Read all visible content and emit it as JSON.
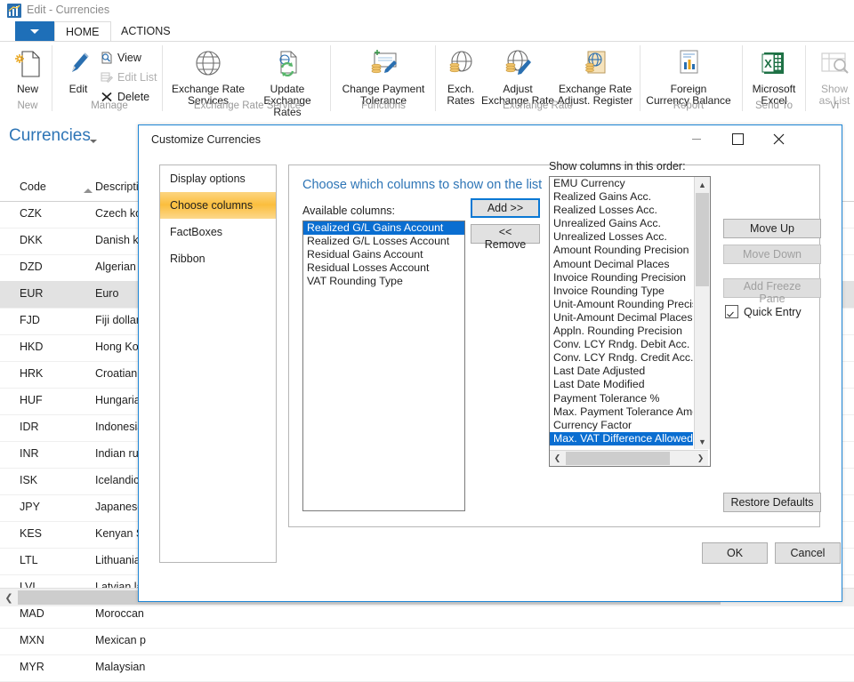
{
  "window": {
    "title": "Edit - Currencies",
    "app_icon": "chart-app-icon"
  },
  "ribbon": {
    "file_menu_label": "",
    "tabs": [
      {
        "label": "HOME",
        "active": true
      },
      {
        "label": "ACTIONS",
        "active": false
      }
    ],
    "groups": [
      {
        "name": "New",
        "items": [
          {
            "label": "New",
            "icon": "new-document-icon",
            "enabled": true
          }
        ]
      },
      {
        "name": "Manage",
        "items": [
          {
            "label": "Edit",
            "icon": "pencil-icon",
            "enabled": true
          },
          {
            "label": "View",
            "icon": "view-icon",
            "enabled": true
          },
          {
            "label": "Edit List",
            "icon": "edit-list-icon",
            "enabled": false
          },
          {
            "label": "Delete",
            "icon": "delete-x-icon",
            "enabled": true
          }
        ]
      },
      {
        "name": "Exchange Rate Service",
        "items": [
          {
            "label": "Exchange Rate\nServices",
            "icon": "globe-icon",
            "enabled": true
          },
          {
            "label": "Update\nExchange Rates",
            "icon": "update-rates-icon",
            "enabled": true
          }
        ]
      },
      {
        "name": "Functions",
        "items": [
          {
            "label": "Change Payment\nTolerance",
            "icon": "payment-tolerance-icon",
            "enabled": true
          }
        ]
      },
      {
        "name": "Exchange Rate",
        "items": [
          {
            "label": "Exch.\nRates",
            "icon": "exchange-rates-icon",
            "enabled": true
          },
          {
            "label": "Adjust\nExchange Rate",
            "icon": "adjust-exchange-rate-icon",
            "enabled": true
          },
          {
            "label": "Exchange Rate\nAdjust. Register",
            "icon": "exchange-rate-register-icon",
            "enabled": true
          }
        ]
      },
      {
        "name": "Report",
        "items": [
          {
            "label": "Foreign\nCurrency Balance",
            "icon": "report-chart-icon",
            "enabled": true
          }
        ]
      },
      {
        "name": "Send To",
        "items": [
          {
            "label": "Microsoft\nExcel",
            "icon": "excel-icon",
            "enabled": true
          }
        ]
      },
      {
        "name": "Vi",
        "items": [
          {
            "label": "Show\nas List",
            "icon": "show-as-list-icon",
            "enabled": false
          }
        ]
      }
    ]
  },
  "page": {
    "title": "Currencies",
    "columns": [
      "Code",
      "Description"
    ],
    "sort_column": "Code",
    "sort_direction": "ascending",
    "rows": [
      {
        "code": "CZK",
        "description": "Czech kor",
        "selected": false
      },
      {
        "code": "DKK",
        "description": "Danish kro",
        "selected": false
      },
      {
        "code": "DZD",
        "description": "Algerian d",
        "selected": false
      },
      {
        "code": "EUR",
        "description": "Euro",
        "selected": true
      },
      {
        "code": "FJD",
        "description": "Fiji dollar",
        "selected": false
      },
      {
        "code": "HKD",
        "description": "Hong Kon",
        "selected": false
      },
      {
        "code": "HRK",
        "description": "Croatian k",
        "selected": false
      },
      {
        "code": "HUF",
        "description": "Hungarian",
        "selected": false
      },
      {
        "code": "IDR",
        "description": "Indonesia",
        "selected": false
      },
      {
        "code": "INR",
        "description": "Indian rup",
        "selected": false
      },
      {
        "code": "ISK",
        "description": "Icelandic k",
        "selected": false
      },
      {
        "code": "JPY",
        "description": "Japanese y",
        "selected": false
      },
      {
        "code": "KES",
        "description": "Kenyan Sh",
        "selected": false
      },
      {
        "code": "LTL",
        "description": "Lithuanian",
        "selected": false
      },
      {
        "code": "LVL",
        "description": "Latvian lat",
        "selected": false
      },
      {
        "code": "MAD",
        "description": "Moroccan",
        "selected": false
      },
      {
        "code": "MXN",
        "description": "Mexican p",
        "selected": false
      },
      {
        "code": "MYR",
        "description": "Malaysian",
        "selected": false
      }
    ]
  },
  "dialog": {
    "title": "Customize Currencies",
    "minimize_label": "minimize-icon",
    "maximize_label": "maximize-icon",
    "close_label": "close-icon",
    "sidebar": [
      {
        "label": "Display options",
        "active": false
      },
      {
        "label": "Choose columns",
        "active": true
      },
      {
        "label": "FactBoxes",
        "active": false
      },
      {
        "label": "Ribbon",
        "active": false
      }
    ],
    "panel_heading": "Choose which columns to show on the list",
    "available_label": "Available columns:",
    "available_columns": [
      {
        "label": "Realized G/L Gains Account",
        "selected": true
      },
      {
        "label": "Realized G/L Losses Account",
        "selected": false
      },
      {
        "label": "Residual Gains Account",
        "selected": false
      },
      {
        "label": "Residual Losses Account",
        "selected": false
      },
      {
        "label": "VAT Rounding Type",
        "selected": false
      }
    ],
    "add_button": "Add >>",
    "remove_button": "<< Remove",
    "shown_label": "Show columns in this order:",
    "shown_columns": [
      {
        "label": "EMU Currency",
        "selected": false
      },
      {
        "label": "Realized Gains Acc.",
        "selected": false
      },
      {
        "label": "Realized Losses Acc.",
        "selected": false
      },
      {
        "label": "Unrealized Gains Acc.",
        "selected": false
      },
      {
        "label": "Unrealized Losses Acc.",
        "selected": false
      },
      {
        "label": "Amount Rounding Precision",
        "selected": false
      },
      {
        "label": "Amount Decimal Places",
        "selected": false
      },
      {
        "label": "Invoice Rounding Precision",
        "selected": false
      },
      {
        "label": "Invoice Rounding Type",
        "selected": false
      },
      {
        "label": "Unit-Amount Rounding Precis",
        "selected": false
      },
      {
        "label": "Unit-Amount Decimal Places",
        "selected": false
      },
      {
        "label": "Appln. Rounding Precision",
        "selected": false
      },
      {
        "label": "Conv. LCY Rndg. Debit Acc.",
        "selected": false
      },
      {
        "label": "Conv. LCY Rndg. Credit Acc.",
        "selected": false
      },
      {
        "label": "Last Date Adjusted",
        "selected": false
      },
      {
        "label": "Last Date Modified",
        "selected": false
      },
      {
        "label": "Payment Tolerance %",
        "selected": false
      },
      {
        "label": "Max. Payment Tolerance Amo",
        "selected": false
      },
      {
        "label": "Currency Factor",
        "selected": false
      },
      {
        "label": "Max. VAT Difference Allowed",
        "selected": true
      }
    ],
    "move_up_button": "Move Up",
    "move_down_button": "Move Down",
    "add_freeze_pane_button": "Add Freeze Pane",
    "quick_entry_label": "Quick Entry",
    "quick_entry_checked": true,
    "restore_defaults_button": "Restore Defaults",
    "ok_button": "OK",
    "cancel_button": "Cancel"
  },
  "colors": {
    "accent_blue": "#2e75b6",
    "selection_blue": "#0a6ed1",
    "tab_orange": "#fbbe3d",
    "dialog_border": "#1e86d6",
    "excel_green": "#1e7145"
  }
}
